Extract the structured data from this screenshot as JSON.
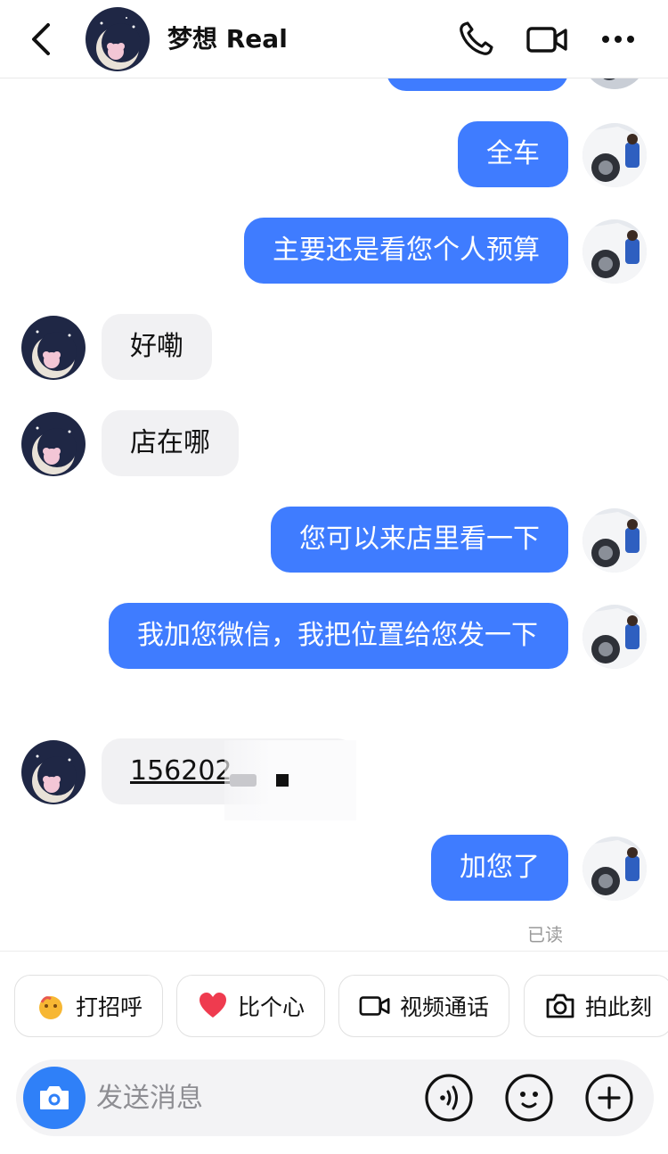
{
  "header": {
    "title": "梦想 Real",
    "back_icon": "chevron-left-icon",
    "phone_icon": "phone-icon",
    "video_icon": "video-camera-icon",
    "more_icon": "more-dots-icon"
  },
  "messages": [
    {
      "side": "out",
      "text": "全车"
    },
    {
      "side": "out",
      "text": "主要还是看您个人预算"
    },
    {
      "side": "in",
      "text": "好嘞"
    },
    {
      "side": "in",
      "text": "店在哪"
    },
    {
      "side": "out",
      "text": "您可以来店里看一下"
    },
    {
      "side": "out",
      "text": "我加您微信，我把位置给您发一下"
    },
    {
      "side": "in",
      "text": "156202"
    },
    {
      "side": "out",
      "text": "加您了"
    }
  ],
  "read_status": "已读",
  "quick_actions": [
    {
      "label": "打招呼",
      "icon": "wave-hand-icon"
    },
    {
      "label": "比个心",
      "icon": "heart-icon"
    },
    {
      "label": "视频通话",
      "icon": "video-camera-icon"
    },
    {
      "label": "拍此刻",
      "icon": "camera-icon"
    }
  ],
  "composer": {
    "placeholder": "发送消息",
    "voice_icon": "voice-icon",
    "emoji_icon": "emoji-icon",
    "plus_icon": "plus-icon"
  },
  "colors": {
    "outgoing_bubble": "#3f7cff",
    "incoming_bubble": "#f1f1f3",
    "camera_button": "#2f80f8"
  }
}
